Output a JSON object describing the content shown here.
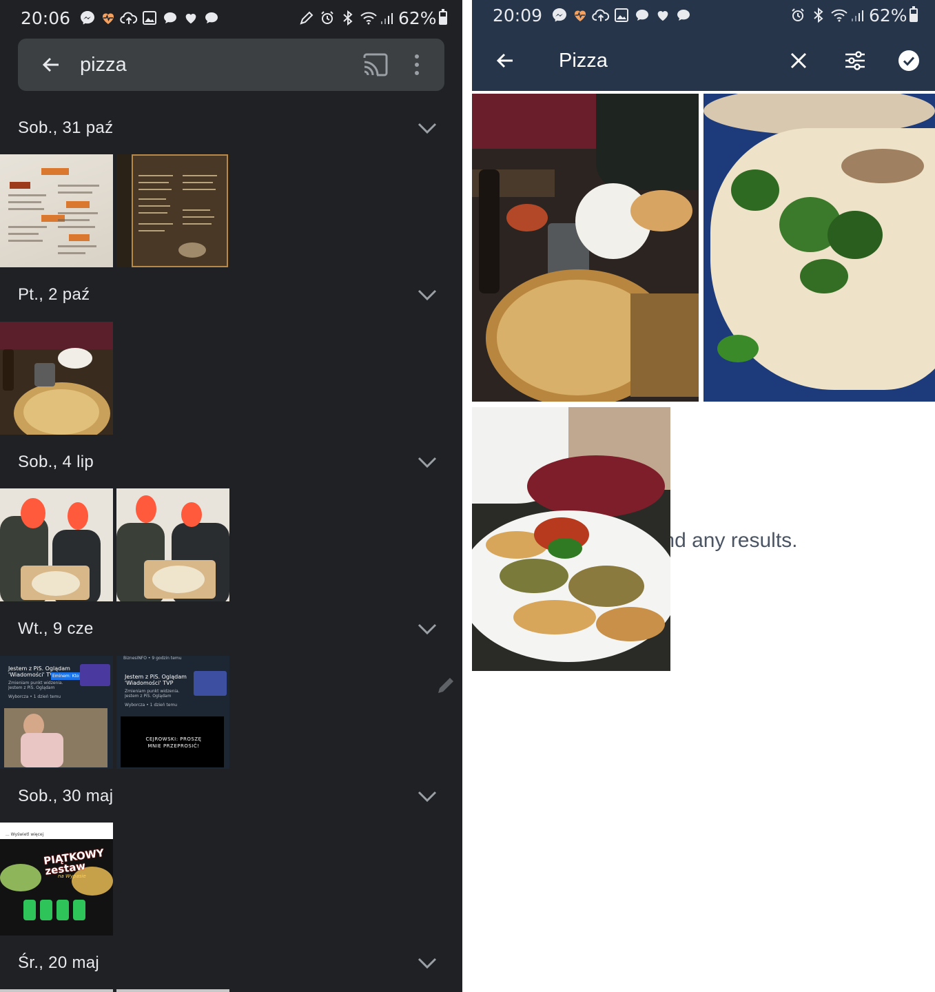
{
  "left": {
    "status": {
      "time": "20:06",
      "battery": "62%"
    },
    "search": {
      "query": "pizza"
    },
    "sections": [
      {
        "date": "Sob., 31 paź"
      },
      {
        "date": "Pt., 2 paź"
      },
      {
        "date": "Sob., 4 lip"
      },
      {
        "date": "Wt., 9 cze"
      },
      {
        "date": "Sob., 30 maj"
      },
      {
        "date": "Śr., 20 maj"
      }
    ],
    "thumb_texts": {
      "news1_title": "Jestem z PiS. Oglądam 'Wiadomości' TVP",
      "news1_tag": "Eminem: Kto co lubi",
      "news1_sub": "Zmieniam punkt widzenia. Jestem z PiS. Oglądam \"Wiadomości\" TVP. Og...",
      "news1_source": "Wyborcza • 1 dzień temu",
      "news2_header": "BiznesINFO • 9 godzin temu",
      "news2_title": "Jestem z PiS. Oglądam 'Wiadomości' TVP",
      "news2_sub": "Zmieniam punkt widzenia. Jestem z PiS. Oglądam \"Wiadomości\" TVP. Og...",
      "news2_source": "Wyborcza • 1 dzień temu",
      "news2_banner": "CEJROWSKI: PROSZĘ MNIE PRZEPROSIĆ!",
      "promo_more": "... Wyświetl więcej",
      "promo_title": "PIĄTKOWY zestaw",
      "promo_sub": "na Wypasie"
    }
  },
  "right": {
    "status": {
      "time": "20:09",
      "battery": "62%"
    },
    "search": {
      "query": "Pizza"
    },
    "no_results_text": "'t find any results."
  },
  "colors": {
    "left_bg": "#202124",
    "left_search_bg": "#3c4043",
    "right_toolbar_bg": "#26354a",
    "accent_orange": "#d9782e"
  }
}
